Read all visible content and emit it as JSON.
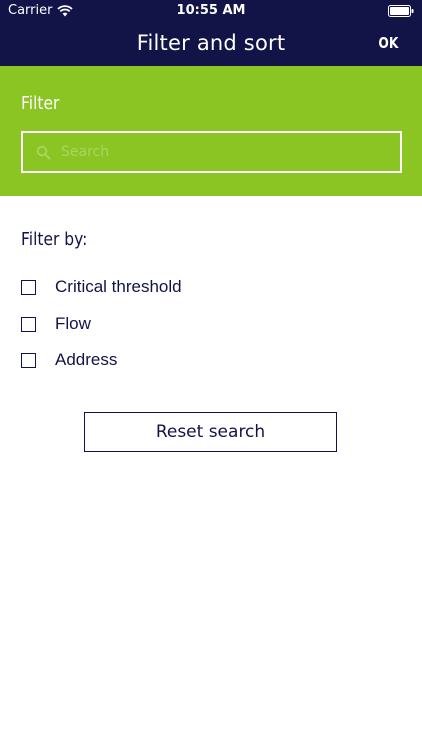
{
  "status_bar": {
    "carrier": "Carrier",
    "time": "10:55 AM"
  },
  "nav": {
    "title": "Filter and sort",
    "ok_label": "OK"
  },
  "filter": {
    "heading": "Filter",
    "search_placeholder": "Search",
    "search_value": ""
  },
  "filter_by": {
    "heading": "Filter by:",
    "options": [
      {
        "label": "Critical threshold",
        "checked": false
      },
      {
        "label": "Flow",
        "checked": false
      },
      {
        "label": "Address",
        "checked": false
      }
    ]
  },
  "reset_label": "Reset search",
  "icons": {
    "wifi": "wifi-icon",
    "battery": "battery-icon",
    "search": "search-icon",
    "checkbox": "checkbox-icon"
  },
  "colors": {
    "navy": "#121347",
    "green": "#8bc523",
    "white": "#ffffff",
    "placeholder": "#a9d65f"
  }
}
